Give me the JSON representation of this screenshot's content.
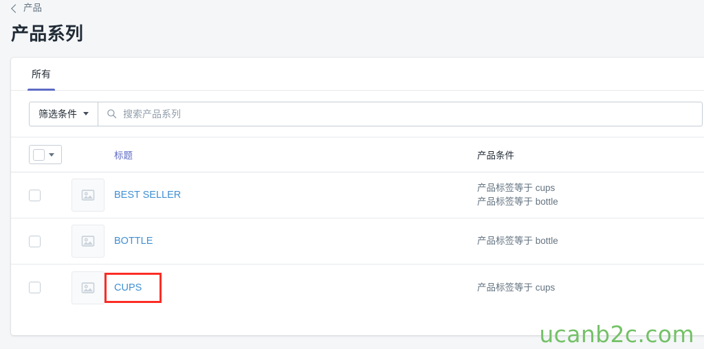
{
  "breadcrumb": {
    "icon": "chevron-left-icon",
    "label": "产品"
  },
  "page": {
    "title": "产品系列"
  },
  "tabs": [
    {
      "label": "所有",
      "active": true
    }
  ],
  "filter": {
    "button_label": "筛选条件",
    "caret_icon": "chevron-down-icon",
    "search_icon": "search-icon",
    "search_value": "",
    "search_placeholder": "搜索产品系列"
  },
  "table": {
    "select_all_icon": "checkbox-icon",
    "select_all_caret_icon": "chevron-down-icon",
    "columns": {
      "title": "标题",
      "conditions": "产品条件"
    },
    "rows": [
      {
        "checkbox_icon": "checkbox-icon",
        "thumb_icon": "image-placeholder-icon",
        "title": "BEST SELLER",
        "conditions": [
          "产品标签等于 cups",
          "产品标签等于 bottle"
        ],
        "highlighted": false
      },
      {
        "checkbox_icon": "checkbox-icon",
        "thumb_icon": "image-placeholder-icon",
        "title": "BOTTLE",
        "conditions": [
          "产品标签等于 bottle"
        ],
        "highlighted": false
      },
      {
        "checkbox_icon": "checkbox-icon",
        "thumb_icon": "image-placeholder-icon",
        "title": "CUPS",
        "conditions": [
          "产品标签等于 cups"
        ],
        "highlighted": true
      }
    ]
  },
  "watermark": {
    "text": "ucanb2c.com",
    "color": "#74c167"
  },
  "colors": {
    "accent": "#5c6ac4",
    "link": "#3f8fd3",
    "highlight": "#fc2c24",
    "background": "#f4f6f8"
  }
}
